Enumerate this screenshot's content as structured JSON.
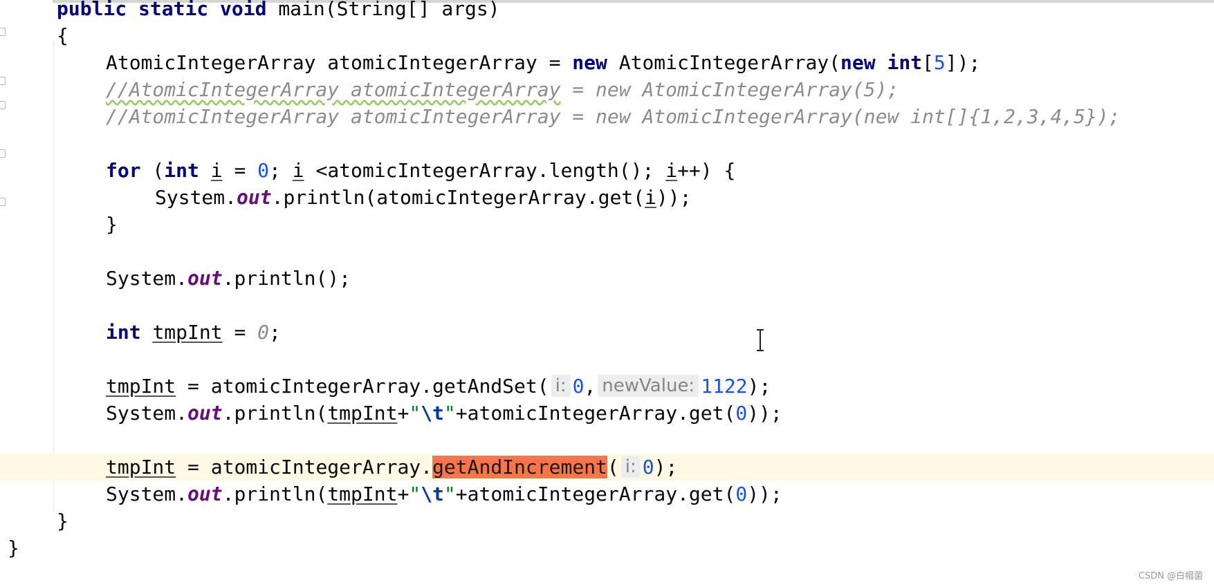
{
  "editor": {
    "lines": [
      {
        "parts": [
          "public",
          " ",
          "static",
          " ",
          "void",
          " main(String[] args)"
        ]
      },
      {
        "text": "{"
      },
      {
        "parts": [
          "AtomicIntegerArray atomicIntegerArray = ",
          "new",
          " AtomicIntegerArray(",
          "new",
          " ",
          "int",
          "[",
          "5",
          "]);"
        ]
      },
      {
        "parts": [
          "//AtomicIntegerArray atomicIntegerArray",
          " = new AtomicIntegerArray(5);"
        ]
      },
      {
        "text": "//AtomicIntegerArray atomicIntegerArray = new AtomicIntegerArray(new int[]{1,2,3,4,5});"
      },
      {
        "parts": [
          "for",
          " (",
          "int",
          " ",
          "i",
          " = ",
          "0",
          "; ",
          "i",
          " <atomicIntegerArray.length(); ",
          "i",
          "++) {"
        ]
      },
      {
        "parts": [
          "System.",
          "out",
          ".println(atomicIntegerArray.get(",
          "i",
          "));"
        ]
      },
      {
        "text": "}"
      },
      {
        "parts": [
          "System.",
          "out",
          ".println();"
        ]
      },
      {
        "parts": [
          "int",
          " ",
          "tmpInt",
          " = ",
          "0",
          ";"
        ]
      },
      {
        "parts": [
          "tmpInt",
          " = atomicIntegerArray.getAndSet(",
          "0",
          ",",
          "1122",
          ");"
        ],
        "hints": [
          "i:",
          "newValue:"
        ]
      },
      {
        "parts": [
          "System.",
          "out",
          ".println(",
          "tmpInt",
          "+",
          "\"",
          "\\t",
          "\"",
          "+atomicIntegerArray.get(",
          "0",
          "));"
        ]
      },
      {
        "parts": [
          "tmpInt",
          " = atomicIntegerArray.",
          "getAndIncrement",
          "(",
          "0",
          ");"
        ],
        "hints": [
          "i:"
        ]
      },
      {
        "parts": [
          "System.",
          "out",
          ".println(",
          "tmpInt",
          "+",
          "\"",
          "\\t",
          "\"",
          "+atomicIntegerArray.get(",
          "0",
          "));"
        ]
      },
      {
        "text": "}"
      },
      {
        "text": "}"
      }
    ]
  },
  "colors": {
    "keyword": "#000080",
    "number": "#1750eb",
    "comment": "#8c8c8c",
    "static_field": "#660e7a",
    "string": "#067d17",
    "current_line": "#fef9e4",
    "search_highlight": "#f77548"
  },
  "gutter": {
    "icons": [
      "fold-marker-icon",
      "lightbulb-icon"
    ]
  },
  "watermark": "CSDN @白帽菌"
}
